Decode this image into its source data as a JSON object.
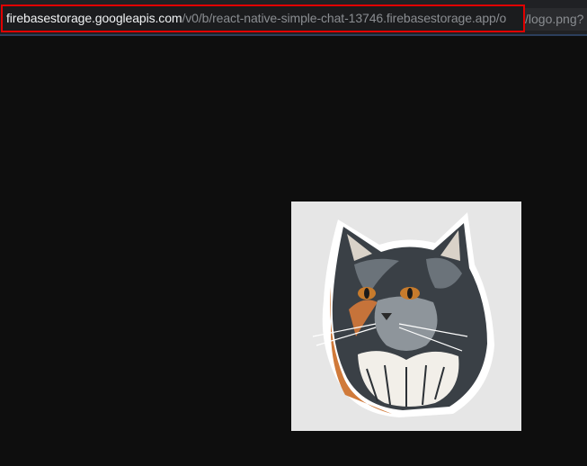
{
  "address_bar": {
    "url_host": "firebasestorage.googleapis.com",
    "url_path_visible": "/v0/b/react-native-simple-chat-13746.firebasestorage.app/o",
    "url_path_overflow": "/logo.png?"
  },
  "viewer": {
    "image_description_icon": "cat-logo-icon",
    "image_background": "#e6e6e6",
    "page_background": "#0e0e0e"
  },
  "colors": {
    "highlight_border": "#e00000",
    "host_text": "#f1f3f4",
    "path_text": "#8a8d91"
  }
}
